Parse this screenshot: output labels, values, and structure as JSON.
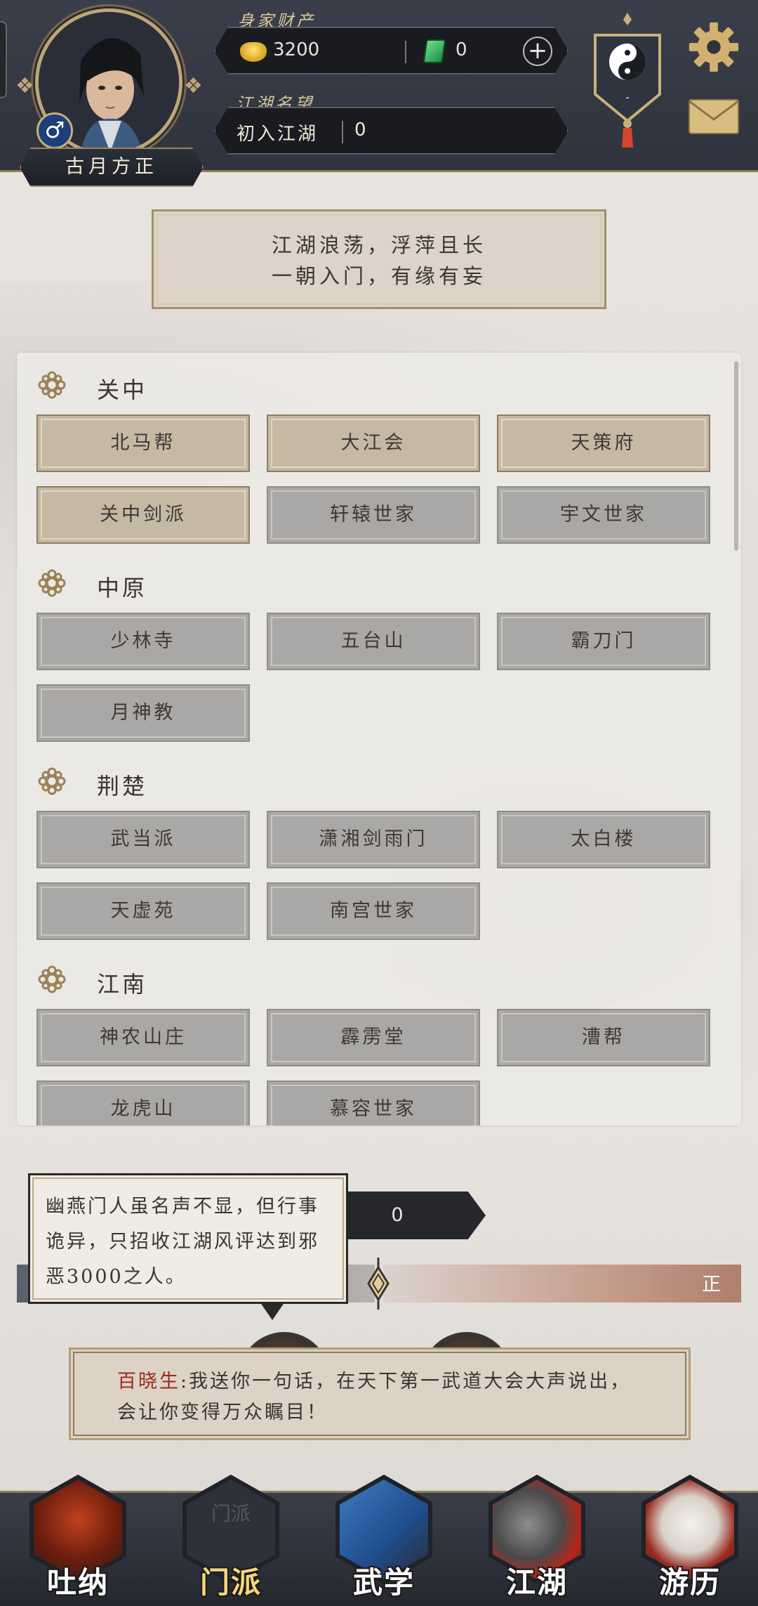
{
  "player": {
    "name": "古月方正",
    "gender_symbol": "♂"
  },
  "assets": {
    "label": "身家财产",
    "gold": "3200",
    "jade": "0",
    "add_symbol": "+"
  },
  "fame": {
    "label": "江湖名望",
    "title": "初入江湖",
    "value": "0"
  },
  "emblem": {
    "text": "-"
  },
  "motto": {
    "line1": "江湖浪荡，浮萍且长",
    "line2": "一朝入门，有缘有妄"
  },
  "regions": [
    {
      "name": "关中",
      "sects": [
        {
          "label": "北马帮",
          "unlocked": true
        },
        {
          "label": "大江会",
          "unlocked": true
        },
        {
          "label": "天策府",
          "unlocked": true
        },
        {
          "label": "关中剑派",
          "unlocked": true
        },
        {
          "label": "轩辕世家",
          "unlocked": false
        },
        {
          "label": "宇文世家",
          "unlocked": false
        }
      ]
    },
    {
      "name": "中原",
      "sects": [
        {
          "label": "少林寺",
          "unlocked": false
        },
        {
          "label": "五台山",
          "unlocked": false
        },
        {
          "label": "霸刀门",
          "unlocked": false
        },
        {
          "label": "月神教",
          "unlocked": false
        }
      ]
    },
    {
      "name": "荆楚",
      "sects": [
        {
          "label": "武当派",
          "unlocked": false
        },
        {
          "label": "潇湘剑雨门",
          "unlocked": false
        },
        {
          "label": "太白楼",
          "unlocked": false
        },
        {
          "label": "天虚苑",
          "unlocked": false
        },
        {
          "label": "南宫世家",
          "unlocked": false
        }
      ]
    },
    {
      "name": "江南",
      "sects": [
        {
          "label": "神农山庄",
          "unlocked": false
        },
        {
          "label": "霹雳堂",
          "unlocked": false
        },
        {
          "label": "漕帮",
          "unlocked": false
        },
        {
          "label": "龙虎山",
          "unlocked": false
        },
        {
          "label": "慕容世家",
          "unlocked": false
        }
      ]
    }
  ],
  "tooltip": {
    "text": "幽燕门人虽名声不显，但行事诡异，只招收江湖风评达到邪恶3000之人。"
  },
  "reputation": {
    "value": "0",
    "right_label": "正"
  },
  "dialog": {
    "speaker": "百晓生",
    "separator": ":",
    "text": "我送你一句话，在天下第一武道大会大声说出，会让你变得万众瞩目！"
  },
  "nav": {
    "items": [
      {
        "label": "吐纳",
        "active": false
      },
      {
        "label": "门派",
        "active": true,
        "ghost": "门派"
      },
      {
        "label": "武学",
        "active": false
      },
      {
        "label": "江湖",
        "active": false
      },
      {
        "label": "游历",
        "active": false
      }
    ]
  },
  "colors": {
    "header_bg": "#2f333d",
    "gold_trim": "#bfa676",
    "sect_unlocked": "#c5b9a4",
    "sect_locked": "#a9a8a6",
    "speaker": "#9c2a1e",
    "active_nav": "#f3d77a"
  }
}
